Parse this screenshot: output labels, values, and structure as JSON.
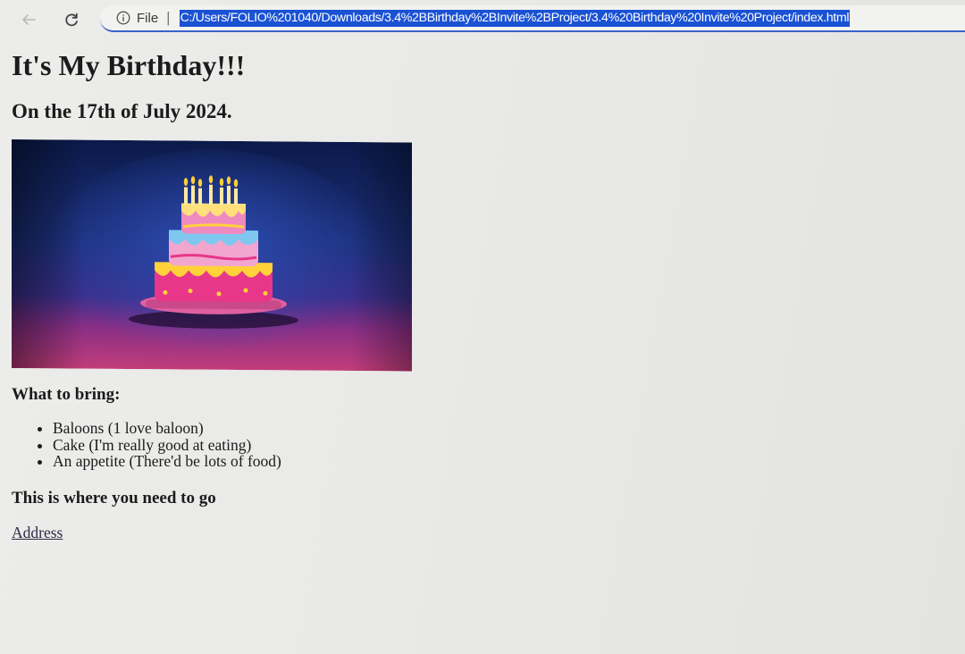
{
  "browser": {
    "file_label": "File",
    "separator": "|",
    "url": "C:/Users/FOLIO%201040/Downloads/3.4%2BBirthday%2BInvite%2BProject/3.4%20Birthday%20Invite%20Project/index.html",
    "icons": {
      "back": "back-arrow-icon",
      "reload": "reload-icon",
      "info": "info-icon"
    },
    "accent_color": "#1a52d4"
  },
  "page": {
    "title": "It's My Birthday!!!",
    "date": "On the 17th of July 2024.",
    "bring_heading": "What to bring:",
    "bring_items": [
      "Baloons (1 love baloon)",
      "Cake (I'm really good at eating)",
      "An appetite (There'd be lots of food)"
    ],
    "location_heading": "This is where you need to go",
    "address_link": "Address"
  }
}
